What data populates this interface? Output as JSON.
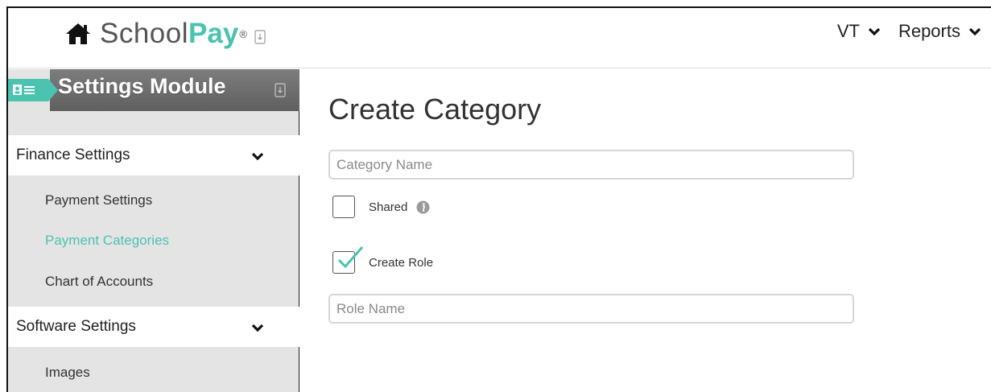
{
  "app": {
    "logo_school": "School",
    "logo_pay": "Pay",
    "logo_reg": "®"
  },
  "topnav": {
    "items": [
      {
        "label": "VT"
      },
      {
        "label": "Reports"
      }
    ]
  },
  "sidebar": {
    "module_title": "Settings Module",
    "sections": [
      {
        "label": "Finance Settings"
      },
      {
        "label": "Software Settings"
      }
    ],
    "finance_items": [
      {
        "label": "Payment Settings"
      },
      {
        "label": "Payment Categories"
      },
      {
        "label": "Chart of Accounts"
      }
    ],
    "software_items": [
      {
        "label": "Images"
      }
    ]
  },
  "main": {
    "title": "Create Category",
    "category_name": {
      "value": "",
      "placeholder": "Category Name"
    },
    "shared": {
      "label": "Shared",
      "checked": false
    },
    "create_role": {
      "label": "Create Role",
      "checked": true
    },
    "role_name": {
      "value": "",
      "placeholder": "Role Name"
    }
  },
  "colors": {
    "accent": "#4cc3b0",
    "module_header": "#6e6e6e",
    "sidebar_bg": "#e4e4e4"
  },
  "icons": {
    "home": "home-icon",
    "card": "id-card-icon",
    "document": "document-download-icon",
    "chevron": "chevron-down-icon",
    "info": "info-icon",
    "check": "checkmark-icon"
  }
}
